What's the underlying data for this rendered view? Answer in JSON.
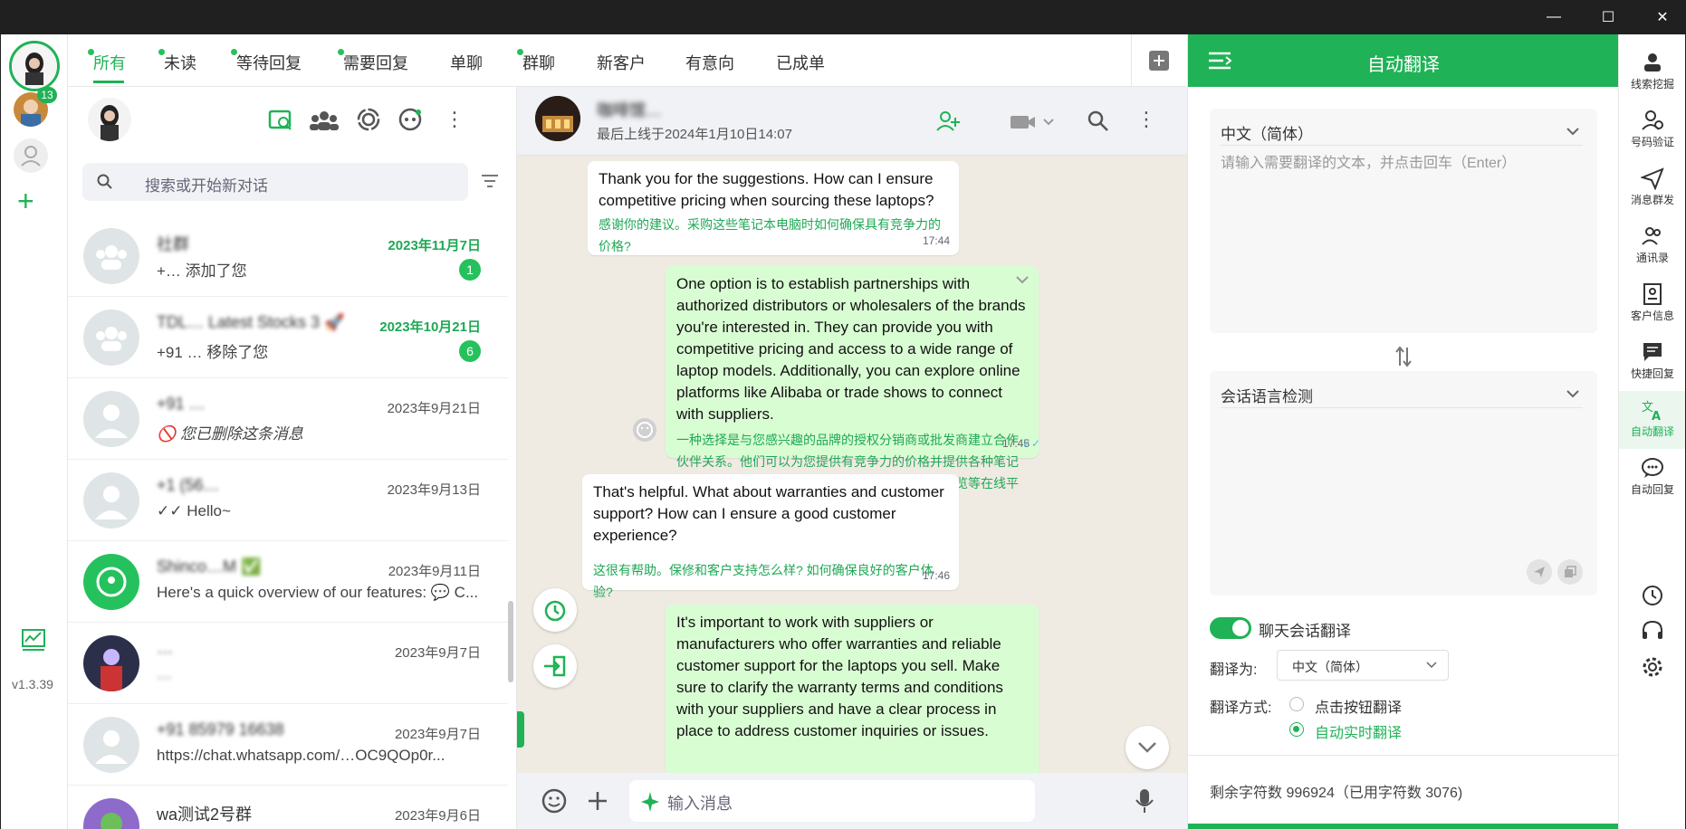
{
  "titlebar": {
    "minimize": "—",
    "maximize": "☐",
    "close": "✕"
  },
  "rail": {
    "badge": "13",
    "add": "+",
    "version": "v1.3.39"
  },
  "tabs": [
    "所有",
    "未读",
    "等待回复",
    "需要回复",
    "单聊",
    "群聊",
    "新客户",
    "有意向",
    "已成单"
  ],
  "search": {
    "placeholder": "搜索或开始新对话"
  },
  "chats": [
    {
      "name": "社群",
      "date": "2023年11月7日",
      "preview": "+… 添加了您",
      "badge": "1",
      "unread": true
    },
    {
      "name": "TDL… Latest Stocks 3 🚀",
      "date": "2023年10月21日",
      "preview": "+91 … 移除了您",
      "badge": "6",
      "unread": true
    },
    {
      "name": "+91 …",
      "date": "2023年9月21日",
      "preview": "🚫 您已删除这条消息",
      "badge": "",
      "unread": false
    },
    {
      "name": "+1 (56…",
      "date": "2023年9月13日",
      "preview": "✓✓ Hello~",
      "badge": "",
      "unread": false
    },
    {
      "name": "Shinco…M ✅",
      "date": "2023年9月11日",
      "preview": "Here's a quick overview of our features: 💬 C...",
      "badge": "",
      "unread": false
    },
    {
      "name": "…",
      "date": "2023年9月7日",
      "preview": "…",
      "badge": "",
      "unread": false
    },
    {
      "name": "+91 85979 16638",
      "date": "2023年9月7日",
      "preview": "https://chat.whatsapp.com/…OC9QOp0r...",
      "badge": "",
      "unread": false
    },
    {
      "name": "wa测试2号群",
      "date": "2023年9月6日",
      "preview": "",
      "badge": "",
      "unread": false
    }
  ],
  "conversation": {
    "name": "咖啡馆…",
    "status": "最后上线于2024年1月10日14:07",
    "messages": [
      {
        "dir": "in",
        "text": "Thank you for the suggestions. How can I ensure competitive pricing when sourcing these laptops?",
        "translation": "感谢你的建议。采购这些笔记本电脑时如何确保具有竞争力的价格?",
        "time": "17:44"
      },
      {
        "dir": "out",
        "text": "One option is to establish partnerships with authorized distributors or wholesalers of the brands you're interested in. They can provide you with competitive pricing and access to a wide range of laptop models. Additionally, you can explore online platforms like Alibaba or trade shows to connect with suppliers.",
        "translation": "一种选择是与您感兴趣的品牌的授权分销商或批发商建立合作伙伴关系。他们可以为您提供有竞争力的价格并提供各种笔记本电脑型号。此外，您可以探索阿里巴巴或贸易展览等在线平台来与供应商建立联系。",
        "time": "17:45"
      },
      {
        "dir": "in",
        "text": "That's helpful. What about warranties and customer support? How can I ensure a good customer experience?",
        "translation": "这很有帮助。保修和客户支持怎么样? 如何确保良好的客户体验?",
        "time": "17:46"
      },
      {
        "dir": "out",
        "text": "It's important to work with suppliers or manufacturers who offer warranties and reliable customer support for the laptops you sell. Make sure to clarify the warranty terms and conditions with your suppliers and have a clear process in place to address customer inquiries or issues.",
        "translation": "",
        "time": ""
      }
    ],
    "input_placeholder": "输入消息"
  },
  "translate": {
    "title": "自动翻译",
    "source_lang": "中文（简体）",
    "source_placeholder": "请输入需要翻译的文本，并点击回车（Enter）",
    "detect_lang": "会话语言检测",
    "chat_translate_label": "聊天会话翻译",
    "translate_to_label": "翻译为:",
    "translate_to_value": "中文（简体）",
    "mode_label": "翻译方式:",
    "mode_button": "点击按钮翻译",
    "mode_realtime": "自动实时翻译",
    "remaining": "剩余字符数 996924（已用字符数 3076)"
  },
  "right_rail": [
    "线索挖掘",
    "号码验证",
    "消息群发",
    "通讯录",
    "客户信息",
    "快捷回复",
    "自动翻译",
    "自动回复"
  ],
  "colors": {
    "accent": "#20b256",
    "outgoing": "#d9fdd3",
    "chat_bg": "#efeae2"
  }
}
